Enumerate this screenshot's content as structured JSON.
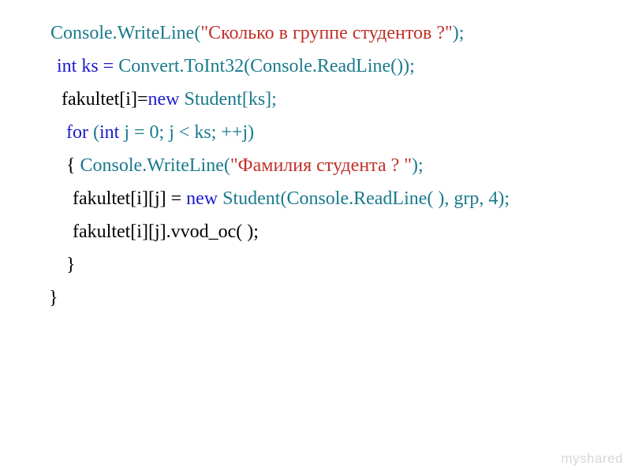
{
  "lines": {
    "l1": {
      "a": "Console.WriteLine(",
      "b": "\"Сколько в группе студентов ?\"",
      "c": ");"
    },
    "l2": {
      "a": "int ks =",
      "b": " Convert.ToInt32(Console.ReadLine());"
    },
    "l3": {
      "a": "fakultet[i]=",
      "b": "new",
      "c": " Student[ks];"
    },
    "l4": {
      "a": "for",
      "b": " (",
      "c": "int",
      "d": " j = 0; j < ks; ++j)"
    },
    "l5": {
      "a": "{",
      "b": "   Console.WriteLine(",
      "c": "\"Фамилия студента ? \"",
      "d": ");"
    },
    "l6": {
      "a": "fakultet[i][j] = ",
      "b": "new",
      "c": " Student(Console.ReadLine(  ), grp, 4);"
    },
    "l7": {
      "a": "fakultet[i][j].vvod_oc(  );"
    },
    "l8": {
      "a": "}"
    },
    "l9": {
      "a": "}"
    }
  },
  "watermark": "myshared"
}
